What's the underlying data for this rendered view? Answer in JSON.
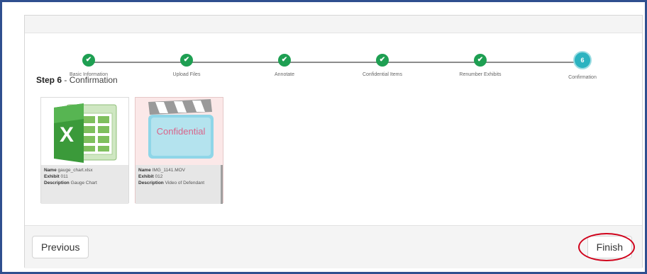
{
  "stepper": {
    "steps": [
      {
        "label": "Basic Information",
        "status": "complete"
      },
      {
        "label": "Upload Files",
        "status": "complete"
      },
      {
        "label": "Annotate",
        "status": "complete"
      },
      {
        "label": "Confidential Items",
        "status": "complete"
      },
      {
        "label": "Renumber Exhibits",
        "status": "complete"
      },
      {
        "label": "Confirmation",
        "status": "active",
        "number": "6"
      }
    ],
    "check_glyph": "✔",
    "complete_color": "#1e9f52",
    "active_color": "#2bb3c0"
  },
  "heading": {
    "step": "Step 6",
    "separator": " - ",
    "title": "Confirmation"
  },
  "files": [
    {
      "name_label": "Name",
      "name": "gauge_chart.xlsx",
      "exhibit_label": "Exhibit",
      "exhibit": "011",
      "description_label": "Description",
      "description": "Gauge Chart",
      "icon": "excel-file-icon"
    },
    {
      "name_label": "Name",
      "name": "IMG_1141.MOV",
      "exhibit_label": "Exhibit",
      "exhibit": "012",
      "description_label": "Description",
      "description": "Video of Defendant",
      "icon": "video-clapperboard-icon",
      "overlay": "Confidential"
    }
  ],
  "footer": {
    "previous_label": "Previous",
    "finish_label": "Finish",
    "highlight_color": "#d0021b"
  }
}
